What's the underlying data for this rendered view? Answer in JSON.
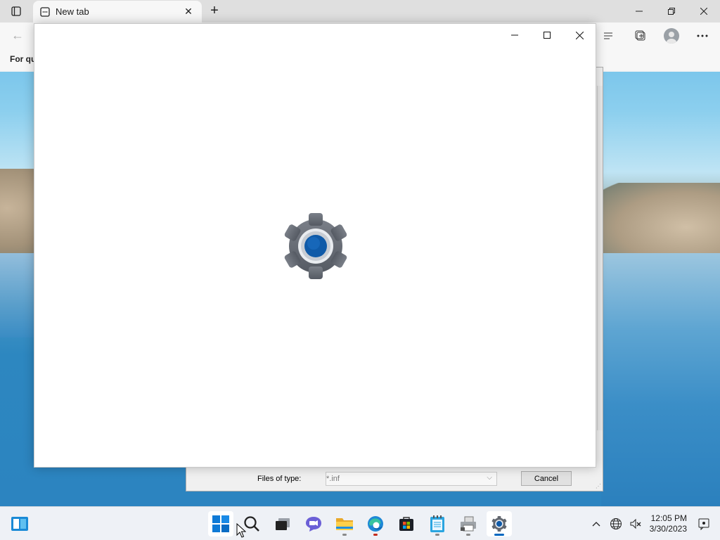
{
  "browser": {
    "tab_label": "New tab",
    "favorites_text": "For qu",
    "controls": {
      "minimize": "minimize",
      "restore": "restore",
      "close": "close"
    }
  },
  "file_dialog": {
    "files_of_type_label": "Files of type:",
    "files_of_type_value": "*.inf",
    "cancel_label": "Cancel"
  },
  "settings_window": {
    "app": "Settings",
    "state": "loading splash"
  },
  "taskbar": {
    "apps": [
      {
        "name": "start",
        "icon": "windows-logo-icon"
      },
      {
        "name": "search",
        "icon": "search-icon"
      },
      {
        "name": "task-view",
        "icon": "task-view-icon"
      },
      {
        "name": "chat",
        "icon": "teams-chat-icon"
      },
      {
        "name": "file-explorer",
        "icon": "folder-icon"
      },
      {
        "name": "edge",
        "icon": "edge-icon"
      },
      {
        "name": "store",
        "icon": "store-icon"
      },
      {
        "name": "notepad",
        "icon": "notepad-icon"
      },
      {
        "name": "printer",
        "icon": "printer-icon"
      },
      {
        "name": "settings",
        "icon": "gear-icon"
      }
    ],
    "clock": {
      "time": "12:05 PM",
      "date": "3/30/2023"
    }
  },
  "colors": {
    "accent": "#0067c0",
    "gear_blue": "#0f5aa8",
    "gear_grey": "#6b7079"
  }
}
